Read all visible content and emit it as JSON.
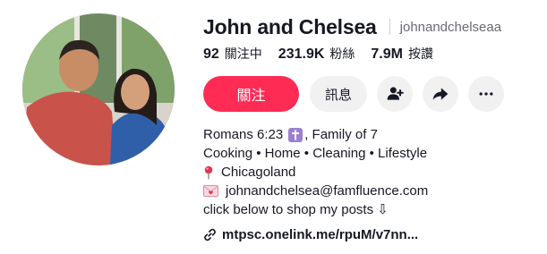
{
  "profile": {
    "display_name": "John and Chelsea",
    "username": "johnandchelseaa"
  },
  "stats": [
    {
      "value": "92",
      "label": "關注中"
    },
    {
      "value": "231.9K",
      "label": "粉絲"
    },
    {
      "value": "7.9M",
      "label": "按讚"
    }
  ],
  "actions": {
    "follow_label": "關注",
    "message_label": "訊息"
  },
  "bio": {
    "line1_before": "Romans 6:23",
    "line1_after": ", Family of 7",
    "line2": "Cooking • Home • Cleaning • Lifestyle",
    "line3": "Chicagoland",
    "line4": "johnandchelsea@famfluence.com",
    "line5": "click below to shop my posts ⇩"
  },
  "link": {
    "text": "mtpsc.onelink.me/rpuM/v7nn..."
  },
  "colors": {
    "accent": "#fe2c55",
    "button_bg": "#f1f1f2",
    "text": "#161823",
    "muted": "#6b6c72"
  },
  "icons": [
    "add-friend-icon",
    "share-icon",
    "more-icon",
    "cross-emoji-icon",
    "pin-emoji-icon",
    "love-letter-icon",
    "link-icon"
  ]
}
